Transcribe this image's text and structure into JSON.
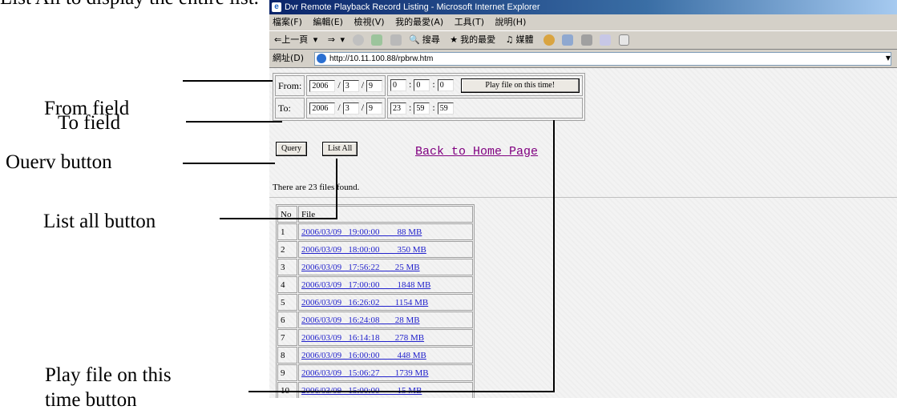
{
  "top_caption": "List All to display the entire list.",
  "callouts": {
    "from_field": "From field",
    "to_field": "To field",
    "query_button": "Ouerv button",
    "list_all_button": "List all  button",
    "play_button_line1": "Play file on this",
    "play_button_line2": "time button"
  },
  "browser": {
    "title": "Dvr Remote Playback Record Listing - Microsoft Internet Explorer",
    "menu": [
      "檔案(F)",
      "編輯(E)",
      "檢視(V)",
      "我的最愛(A)",
      "工具(T)",
      "說明(H)"
    ],
    "toolbar": {
      "back": "⇐上一頁",
      "forward": "⇒",
      "search": "搜尋",
      "favorites": "我的最愛",
      "media": "媒體"
    },
    "address_label": "網址(D)",
    "address": "http://10.11.100.88/rpbrw.htm"
  },
  "form": {
    "from_label": "From:",
    "to_label": "To:",
    "from": {
      "year": "2006",
      "month": "3",
      "day": "9",
      "hour": "0",
      "min": "0",
      "sec": "0"
    },
    "to": {
      "year": "2006",
      "month": "3",
      "day": "9",
      "hour": "23",
      "min": "59",
      "sec": "59"
    },
    "date_sep": "/",
    "time_sep": ":",
    "play_button": "Play file on this time!",
    "query_button": "Query",
    "list_all_button": "List All",
    "home_link": "Back to Home Page"
  },
  "results": {
    "found_text": "There are 23 files found.",
    "headers": [
      "No",
      "File"
    ],
    "rows": [
      {
        "no": "1",
        "file": "2006/03/09   19:00:00        88 MB"
      },
      {
        "no": "2",
        "file": "2006/03/09   18:00:00        350 MB"
      },
      {
        "no": "3",
        "file": "2006/03/09   17:56:22       25 MB"
      },
      {
        "no": "4",
        "file": "2006/03/09   17:00:00        1848 MB"
      },
      {
        "no": "5",
        "file": "2006/03/09   16:26:02       1154 MB"
      },
      {
        "no": "6",
        "file": "2006/03/09   16:24:08       28 MB"
      },
      {
        "no": "7",
        "file": "2006/03/09   16:14:18       278 MB"
      },
      {
        "no": "8",
        "file": "2006/03/09   16:00:00        448 MB"
      },
      {
        "no": "9",
        "file": "2006/03/09   15:06:27       1739 MB"
      },
      {
        "no": "10",
        "file": "2006/03/09   15:00:00        15 MB"
      }
    ]
  }
}
